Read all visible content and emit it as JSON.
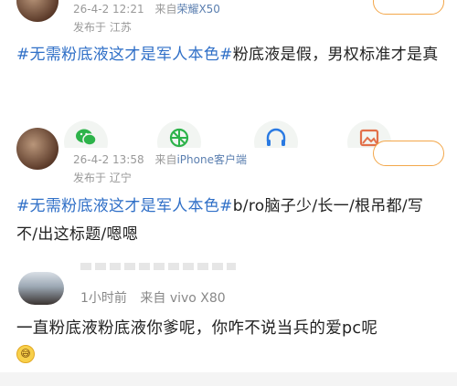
{
  "posts": [
    {
      "date": "26-4-2 12:21",
      "source_prefix": "来自",
      "device": "荣耀X50",
      "location": "发布于 江苏",
      "tag": "#无需粉底液这才是军人本色#",
      "body": "粉底液是假，男权标准才是真"
    },
    {
      "date": "26-4-2 13:58",
      "source_prefix": "来自",
      "device": "iPhone客户端",
      "location": "发布于 辽宁",
      "tag": "#无需粉底液这才是军人本色#",
      "body": "b/ro脑子少/长一/根吊都/写不/出这标题/嗯嗯"
    }
  ],
  "comment": {
    "time": "1小时前",
    "source": "来自 vivo X80",
    "body": "一直粉底液粉底液你爹呢，你咋不说当兵的爱pc呢",
    "emoji": "😅"
  },
  "action_icons": [
    "wechat-icon",
    "moments-icon",
    "headphones-icon",
    "image-icon"
  ],
  "colors": {
    "hashtag": "#2f6fc7",
    "device": "#5b7fb0",
    "meta": "#999999",
    "follow_border": "#f3a74a"
  }
}
